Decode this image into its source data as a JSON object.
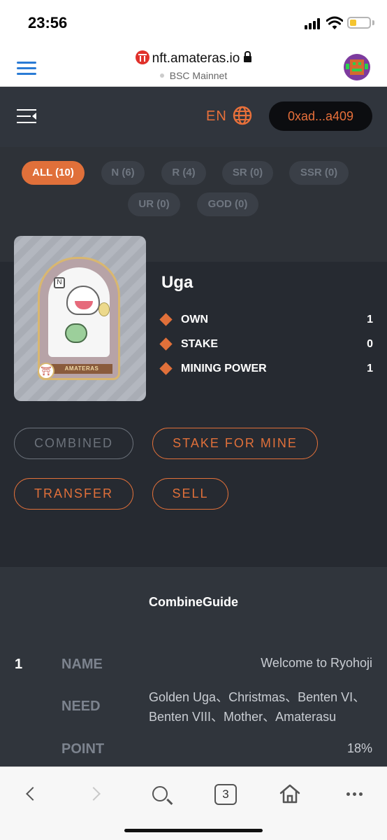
{
  "status_bar": {
    "time": "23:56"
  },
  "browser": {
    "url": "nft.amateras.io",
    "network": "BSC Mainnet",
    "tab_count": "3"
  },
  "header": {
    "language": "EN",
    "wallet": "0xad...a409",
    "accent_color": "#e0703a"
  },
  "filters": [
    {
      "label": "ALL (10)",
      "active": true
    },
    {
      "label": "N (6)",
      "active": false
    },
    {
      "label": "R (4)",
      "active": false
    },
    {
      "label": "SR (0)",
      "active": false
    },
    {
      "label": "SSR (0)",
      "active": false
    },
    {
      "label": "UR (0)",
      "active": false
    },
    {
      "label": "GOD (0)",
      "active": false
    }
  ],
  "nft": {
    "card_badge": "N",
    "card_ribbon": "AMATERAS",
    "name": "Uga",
    "stats": [
      {
        "label": "OWN",
        "value": "1"
      },
      {
        "label": "STAKE",
        "value": "0"
      },
      {
        "label": "MINING POWER",
        "value": "1"
      }
    ]
  },
  "actions": {
    "combined": "COMBINED",
    "stake_for_mine": "STAKE FOR MINE",
    "transfer": "TRANSFER",
    "sell": "SELL"
  },
  "combine_guide": {
    "title": "CombineGuide",
    "items": [
      {
        "index": "1",
        "name_label": "NAME",
        "name_value": "Welcome to Ryohoji",
        "need_label": "NEED",
        "need_value": "Golden Uga、Christmas、Benten VI、Benten VIII、Mother、Amaterasu",
        "point_label": "POINT",
        "point_value": "18%"
      }
    ]
  },
  "icons": {
    "menu": "hamburger-icon",
    "lock": "lock-icon",
    "globe": "globe-icon",
    "collapse": "menu-collapse-icon",
    "diamond": "diamond-icon",
    "back": "back-icon",
    "forward": "forward-icon",
    "search": "search-icon",
    "home": "home-icon",
    "more": "more-icon"
  }
}
